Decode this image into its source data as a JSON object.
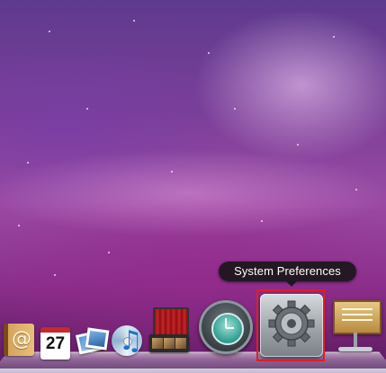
{
  "tooltip": {
    "text": "System Preferences"
  },
  "calendar": {
    "date": "27"
  },
  "colors": {
    "highlight": "#e02020",
    "tooltip_bg": "#141414"
  },
  "dock": {
    "items": [
      {
        "name": "Address Book",
        "icon": "address-book-icon"
      },
      {
        "name": "iCal",
        "icon": "ical-icon"
      },
      {
        "name": "Preview",
        "icon": "preview-icon"
      },
      {
        "name": "iTunes",
        "icon": "itunes-icon"
      },
      {
        "name": "iMovie",
        "icon": "imovie-icon"
      },
      {
        "name": "Time Machine",
        "icon": "time-machine-icon"
      },
      {
        "name": "System Preferences",
        "icon": "system-preferences-icon"
      },
      {
        "name": "Keynote",
        "icon": "keynote-icon"
      }
    ]
  }
}
